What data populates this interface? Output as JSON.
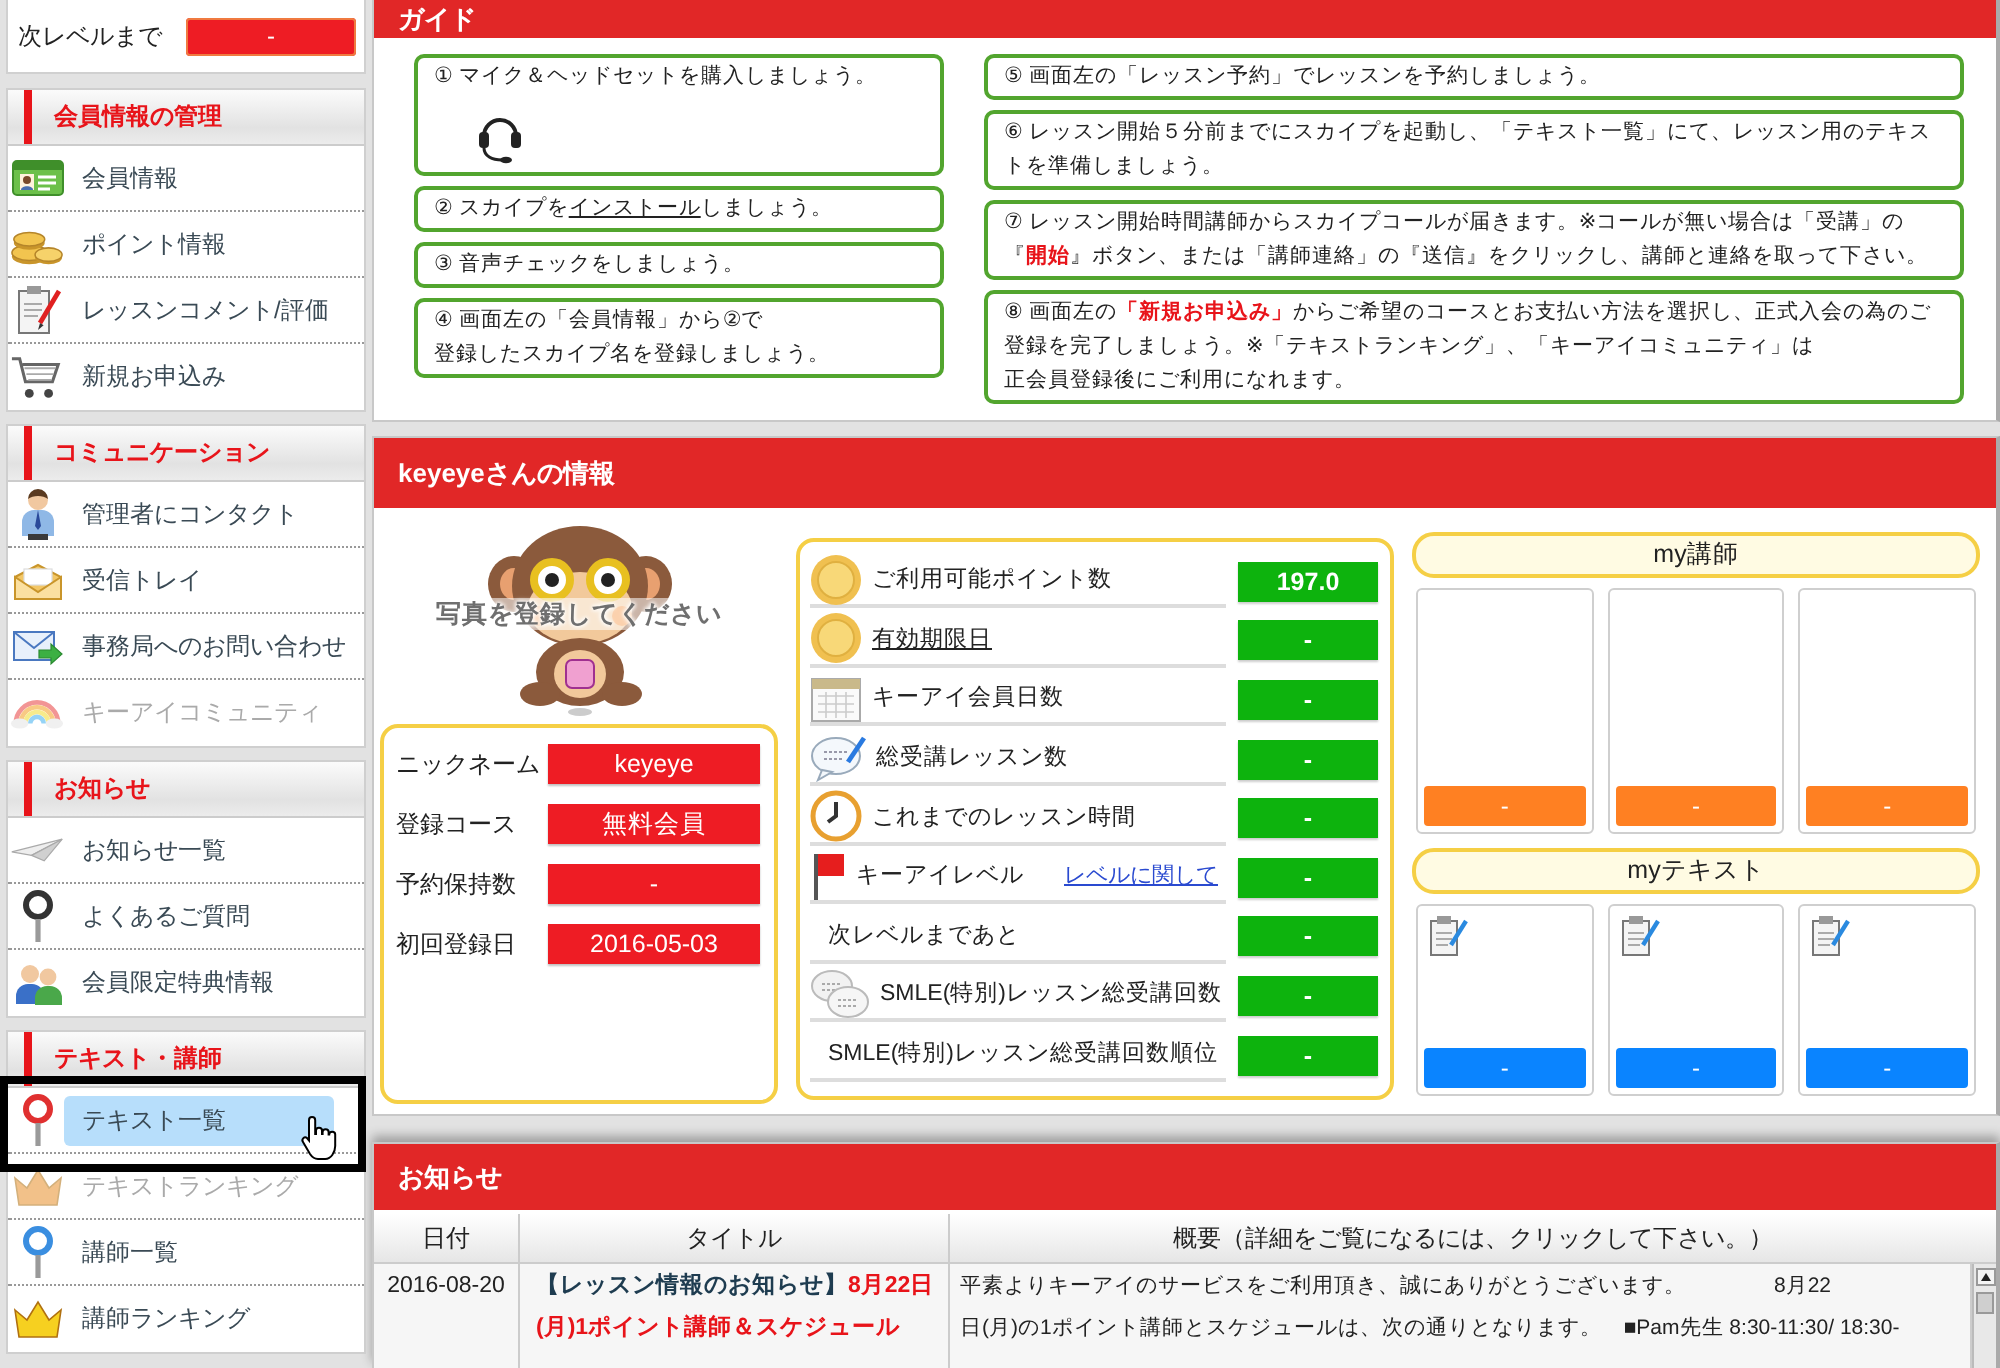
{
  "sidebar": {
    "next_level": {
      "label": "次レベルまで",
      "value": "-"
    },
    "sections": [
      {
        "title": "会員情報の管理",
        "items": [
          {
            "label": "会員情報",
            "disabled": false,
            "selected": false,
            "outlined": false
          },
          {
            "label": "ポイント情報",
            "disabled": false,
            "selected": false,
            "outlined": false
          },
          {
            "label": "レッスンコメント/評価",
            "disabled": false,
            "selected": false,
            "outlined": false
          },
          {
            "label": "新規お申込み",
            "disabled": false,
            "selected": false,
            "outlined": false
          }
        ]
      },
      {
        "title": "コミュニケーション",
        "items": [
          {
            "label": "管理者にコンタクト",
            "disabled": false,
            "selected": false,
            "outlined": false
          },
          {
            "label": "受信トレイ",
            "disabled": false,
            "selected": false,
            "outlined": false
          },
          {
            "label": "事務局へのお問い合わせ",
            "disabled": false,
            "selected": false,
            "outlined": false
          },
          {
            "label": "キーアイコミュニティ",
            "disabled": true,
            "selected": false,
            "outlined": false
          }
        ]
      },
      {
        "title": "お知らせ",
        "items": [
          {
            "label": "お知らせ一覧",
            "disabled": false,
            "selected": false,
            "outlined": false
          },
          {
            "label": "よくあるご質問",
            "disabled": false,
            "selected": false,
            "outlined": false
          },
          {
            "label": "会員限定特典情報",
            "disabled": false,
            "selected": false,
            "outlined": false
          }
        ]
      },
      {
        "title": "テキスト・講師",
        "items": [
          {
            "label": "テキスト一覧",
            "disabled": false,
            "selected": true,
            "outlined": true
          },
          {
            "label": "テキストランキング",
            "disabled": true,
            "selected": false,
            "outlined": false
          },
          {
            "label": "講師一覧",
            "disabled": false,
            "selected": false,
            "outlined": false
          },
          {
            "label": "講師ランキング",
            "disabled": false,
            "selected": false,
            "outlined": false
          }
        ]
      }
    ]
  },
  "guide": {
    "title": "ガイド",
    "left_steps": [
      {
        "kind": "media",
        "parts": [
          {
            "kind": "text",
            "text": "① マイク＆ヘッドセットを購入しましょう。"
          }
        ]
      },
      {
        "kind": "plain",
        "parts": [
          {
            "kind": "text",
            "text": "② スカイプを"
          },
          {
            "kind": "link",
            "text": "インストール"
          },
          {
            "kind": "text",
            "text": "しましょう。"
          }
        ]
      },
      {
        "kind": "plain",
        "parts": [
          {
            "kind": "text",
            "text": "③ 音声チェックをしましょう。"
          }
        ]
      },
      {
        "kind": "plain",
        "parts": [
          {
            "kind": "text",
            "text": "④ 画面左の「会員情報」から②で"
          },
          {
            "kind": "break"
          },
          {
            "kind": "text",
            "text": "登録したスカイプ名を登録しましょう。"
          }
        ]
      }
    ],
    "right_steps": [
      {
        "kind": "plain",
        "parts": [
          {
            "kind": "text",
            "text": "⑤ 画面左の「レッスン予約」でレッスンを予約しましょう。"
          }
        ]
      },
      {
        "kind": "plain",
        "parts": [
          {
            "kind": "text",
            "text": "⑥ レッスン開始５分前までにスカイプを起動し、「テキスト一覧」にて、レッスン用のテキストを準備しましょう。"
          }
        ]
      },
      {
        "kind": "plain",
        "parts": [
          {
            "kind": "text",
            "text": "⑦ レッスン開始時間講師からスカイプコールが届きます。※コールが無い場合は「受講」の『**開始**』ボタン、または「講師連絡」の『送信』をクリックし、講師と連絡を取って下さい。"
          }
        ]
      },
      {
        "kind": "plain",
        "parts": [
          {
            "kind": "text",
            "text": "⑧ 画面左の**「新規お申込み」**からご希望のコースとお支払い方法を選択し、正式入会の為のご登録を完了しましょう。※「テキストランキング」、「キーアイコミュニティ」は"
          },
          {
            "kind": "break"
          },
          {
            "kind": "text",
            "text": "正会員登録後にご利用になれます。"
          }
        ]
      }
    ]
  },
  "member": {
    "title": "keyeyeさんの情報",
    "photo_caption": "写真を登録してください",
    "profile": [
      {
        "label": "ニックネーム",
        "value": "keyeye"
      },
      {
        "label": "登録コース",
        "value": "無料会員"
      },
      {
        "label": "予約保持数",
        "value": "-"
      },
      {
        "label": "初回登録日",
        "value": "2016-05-03"
      }
    ],
    "stats": [
      {
        "label": "ご利用可能ポイント数",
        "kind": "text",
        "value": "197.0"
      },
      {
        "label": "有効期限日",
        "kind": "link",
        "value": "-"
      },
      {
        "label": "キーアイ会員日数",
        "kind": "text",
        "value": "-"
      },
      {
        "label": "総受講レッスン数",
        "kind": "text",
        "value": "-"
      },
      {
        "label": "これまでのレッスン時間",
        "kind": "text",
        "value": "-"
      },
      {
        "label": "キーアイレベル",
        "kind": "text",
        "link": "レベルに関して",
        "value": "-"
      },
      {
        "label": "次レベルまであと",
        "kind": "text",
        "value": "-"
      },
      {
        "label": "SMLE(特別)レッスン総受講回数",
        "kind": "text",
        "value": "-"
      },
      {
        "label": "SMLE(特別)レッスン総受講回数順位",
        "kind": "text",
        "value": "-"
      }
    ],
    "my_teachers": {
      "title": "my講師",
      "cards": [
        {
          "button": "-"
        },
        {
          "button": "-"
        },
        {
          "button": "-"
        }
      ]
    },
    "my_texts": {
      "title": "myテキスト",
      "cards": [
        {
          "button": "-"
        },
        {
          "button": "-"
        },
        {
          "button": "-"
        }
      ]
    }
  },
  "notices": {
    "title": "お知らせ",
    "columns": [
      "日付",
      "タイトル",
      "概要（詳細をご覧になるには、クリックして下さい。）"
    ],
    "rows": [
      {
        "date": "2016-08-20",
        "category": "【レッスン情報のお知らせ】",
        "headline": "8月22日(月)1ポイント講師＆スケジュール",
        "summary_lines": [
          "平素よりキーアイのサービスをご利用頂き、誠にありがとうございます。　　　　8月22",
          "日(月)の1ポイント講師とスケジュールは、次の通りとなります。　■Pam先生 8:30-11:30/ 18:30-"
        ]
      }
    ]
  }
}
